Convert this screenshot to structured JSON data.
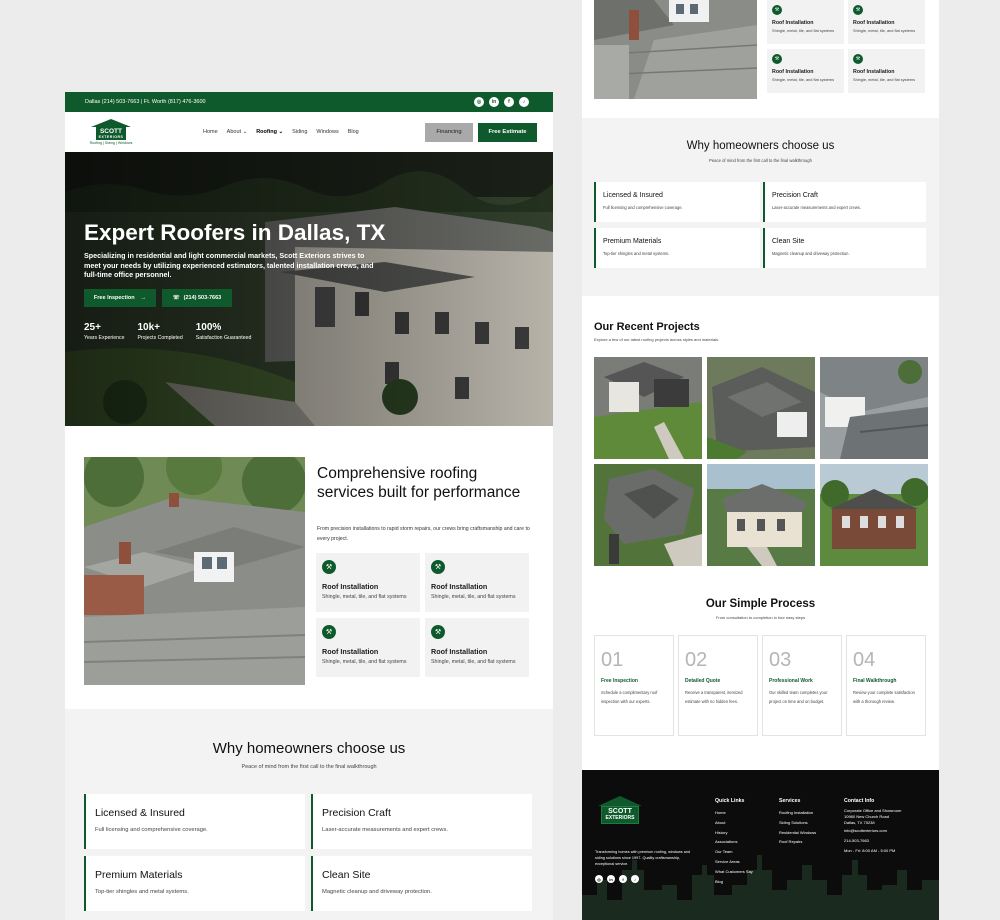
{
  "brand": {
    "logo_top": "SCOTT",
    "logo_sub": "EXTERIORS",
    "tagline": "Roofing | Siding | Windows",
    "green": "#0f5a2c"
  },
  "topbar": {
    "phones": "Dallas (214) 503-7663  |  Ft. Worth (817) 476-3600",
    "socials": [
      "instagram-icon",
      "linkedin-icon",
      "facebook-icon",
      "tiktok-icon"
    ],
    "social_glyphs": [
      "◎",
      "in",
      "f",
      "♪"
    ]
  },
  "nav": {
    "items": [
      "Home",
      "About",
      "Roofing",
      "Siding",
      "Windows",
      "Blog"
    ],
    "financing": "Financing",
    "estimate": "Free Estimate"
  },
  "hero": {
    "title": "Expert Roofers in Dallas, TX",
    "text": "Specializing in residential and light commercial markets, Scott Exteriors strives to meet your needs by utilizing experienced estimators, talented installation crews, and full-time office personnel.",
    "cta1": "Free Inspection",
    "cta2": "(214) 503-7663",
    "stats": [
      {
        "n": "25+",
        "l": "Years Experience"
      },
      {
        "n": "10k+",
        "l": "Projects Completed"
      },
      {
        "n": "100%",
        "l": "Satisfaction Guaranteed"
      }
    ]
  },
  "services": {
    "title": "Comprehensive roofing services built for performance",
    "desc": "From precision installations to rapid storm repairs, our crews bring craftsmanship and care to every project.",
    "cards": [
      {
        "t": "Roof Installation",
        "s": "Shingle, metal, tile, and flat systems"
      },
      {
        "t": "Roof Installation",
        "s": "Shingle, metal, tile, and flat systems"
      },
      {
        "t": "Roof Installation",
        "s": "Shingle, metal, tile, and flat systems"
      },
      {
        "t": "Roof Installation",
        "s": "Shingle, metal, tile, and flat systems"
      }
    ]
  },
  "why": {
    "title": "Why homeowners choose us",
    "sub": "Peace of mind from the first call to the final walkthrough",
    "cards": [
      {
        "t": "Licensed & Insured",
        "s": "Full licensing and comprehensive coverage."
      },
      {
        "t": "Precision Craft",
        "s": "Laser-accurate measurements and expert crews."
      },
      {
        "t": "Premium Materials",
        "s": "Top-tier shingles and metal systems."
      },
      {
        "t": "Clean Site",
        "s": "Magnetic cleanup and driveway protection."
      }
    ]
  },
  "projects": {
    "title": "Our Recent Projects",
    "sub": "Explore a few of our latest roofing projects across styles and materials."
  },
  "process": {
    "title": "Our Simple Process",
    "sub": "From consultation to completion in four easy steps",
    "steps": [
      {
        "n": "01",
        "t": "Free Inspection",
        "s": "Schedule a complimentary roof inspection with our experts."
      },
      {
        "n": "02",
        "t": "Detailed Quote",
        "s": "Receive a transparent, itemized estimate with no hidden fees."
      },
      {
        "n": "03",
        "t": "Professional Work",
        "s": "Our skilled team completes your project on time and on budget."
      },
      {
        "n": "04",
        "t": "Final Walkthrough",
        "s": "Review your complete satisfaction with a thorough review."
      }
    ]
  },
  "footer": {
    "text": "Transforming homes with premium roofing, windows and siding solutions since 1997. Quality craftsmanship, exceptional service.",
    "quick_title": "Quick Links",
    "quick": [
      "Home",
      "About",
      "History",
      "Associations",
      "Our Team",
      "Service Areas",
      "What Customers Say",
      "Blog"
    ],
    "services_title": "Services",
    "services": [
      "Roofing Installation",
      "Siding Solutions",
      "Residential Windows",
      "Roof Repairs"
    ],
    "contact_title": "Contact Info",
    "contact": [
      "Corporate Office and Showroom",
      "10980 New Church Road",
      "Dallas, TX 75238",
      "info@scottexteriors.com",
      "214-503-7663",
      "Mon - Fri: 8:00 AM - 5:00 PM"
    ]
  }
}
